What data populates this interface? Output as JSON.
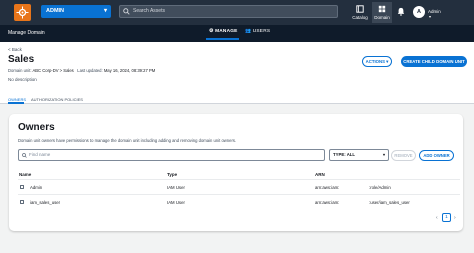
{
  "topbar": {
    "domain_select": "ADMIN",
    "search_placeholder": "Search Assets",
    "catalog_label": "Catalog",
    "domain_label": "Domain",
    "avatar_initial": "A",
    "user_name": "Admin"
  },
  "subnav": {
    "title": "Manage Domain",
    "tabs": [
      {
        "label": "MANAGE",
        "active": true,
        "icon": "gear-icon"
      },
      {
        "label": "USERS",
        "active": false,
        "icon": "users-icon"
      }
    ]
  },
  "header": {
    "back_label": "< Back",
    "title": "Sales",
    "meta_domain_label": "Domain unit: ",
    "meta_domain_value": "ABC Corp-DV > Sales",
    "meta_updated_label": "Last updated: ",
    "meta_updated_value": "May 16, 2024, 08:39:27 PM",
    "description": "No description",
    "actions_label": "ACTIONS ▾",
    "create_label": "CREATE CHILD DOMAIN UNIT"
  },
  "section_tabs": [
    {
      "label": "OWNERS",
      "active": true
    },
    {
      "label": "AUTHORIZATION POLICIES",
      "active": false
    }
  ],
  "owners": {
    "title": "Owners",
    "description": "Domain unit owners have permissions to manage the domain unit including adding and removing domain unit owners.",
    "find_placeholder": "Find name",
    "type_filter": "TYPE: ALL",
    "remove_label": "REMOVE",
    "add_label": "ADD OWNER",
    "columns": [
      "Name",
      "Type",
      "ARN"
    ],
    "rows": [
      {
        "name": "Admin",
        "type": "IAM User",
        "arn_prefix": "arn:aws:iam:",
        "arn_suffix": ":role/Admin"
      },
      {
        "name": "iam_sales_user",
        "type": "IAM User",
        "arn_prefix": "arn:aws:iam:",
        "arn_suffix": ":user/iam_sales_user"
      }
    ],
    "pagination": {
      "prev": "‹",
      "page": "1",
      "next": "›"
    }
  },
  "colors": {
    "topbar_bg": "#232f3e",
    "accent": "#0972d3",
    "logo": "#e8751a"
  }
}
